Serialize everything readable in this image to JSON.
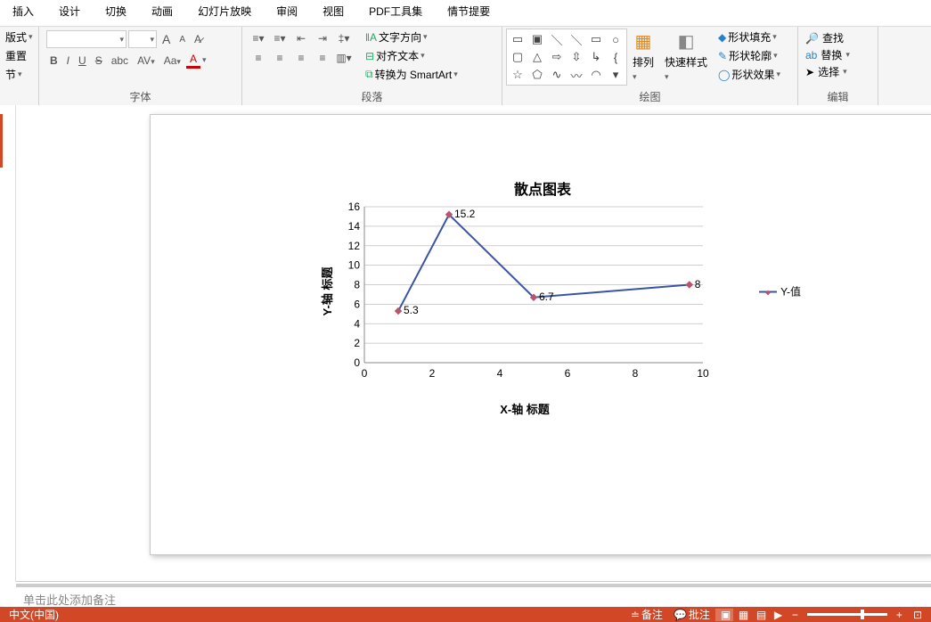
{
  "menu": [
    "插入",
    "设计",
    "切换",
    "动画",
    "幻灯片放映",
    "审阅",
    "视图",
    "PDF工具集",
    "情节提要"
  ],
  "ribbon": {
    "clipboard": {
      "items": [
        "版式",
        "重置",
        "节"
      ],
      "dd": "▾"
    },
    "font": {
      "label": "字体",
      "bold": "B",
      "italic": "I",
      "underline": "U",
      "strike": "S",
      "abc": "abc",
      "av": "AV",
      "aa": "Aa",
      "a_big": "A",
      "a_small": "A",
      "dd": "▾"
    },
    "paragraph": {
      "label": "段落",
      "textdir": "文字方向",
      "align": "对齐文本",
      "smartart": "转换为 SmartArt"
    },
    "drawing": {
      "label": "绘图",
      "arrange": "排列",
      "quickstyle": "快速样式",
      "fill": "形状填充",
      "outline": "形状轮廓",
      "effects": "形状效果"
    },
    "editing": {
      "label": "编辑",
      "find": "查找",
      "replace": "替换",
      "select": "选择"
    }
  },
  "chart_data": {
    "type": "scatter",
    "title": "散点图表",
    "xlabel": "X-轴 标题",
    "ylabel": "Y-轴 标题",
    "legend": "Y-值",
    "x_ticks": [
      0,
      2,
      4,
      6,
      8,
      10
    ],
    "y_ticks": [
      0,
      2,
      4,
      6,
      8,
      10,
      12,
      14,
      16
    ],
    "xlim": [
      0,
      10
    ],
    "ylim": [
      0,
      16
    ],
    "series": [
      {
        "name": "Y-值",
        "x": [
          1,
          2.5,
          5,
          9.6
        ],
        "y": [
          5.3,
          15.2,
          6.7,
          8
        ],
        "labels": [
          "5.3",
          "15.2",
          "6.7",
          "8"
        ]
      }
    ]
  },
  "notes_placeholder": "单击此处添加备注",
  "status": {
    "lang": "中文(中国)",
    "notes": "备注",
    "comments": "批注"
  }
}
